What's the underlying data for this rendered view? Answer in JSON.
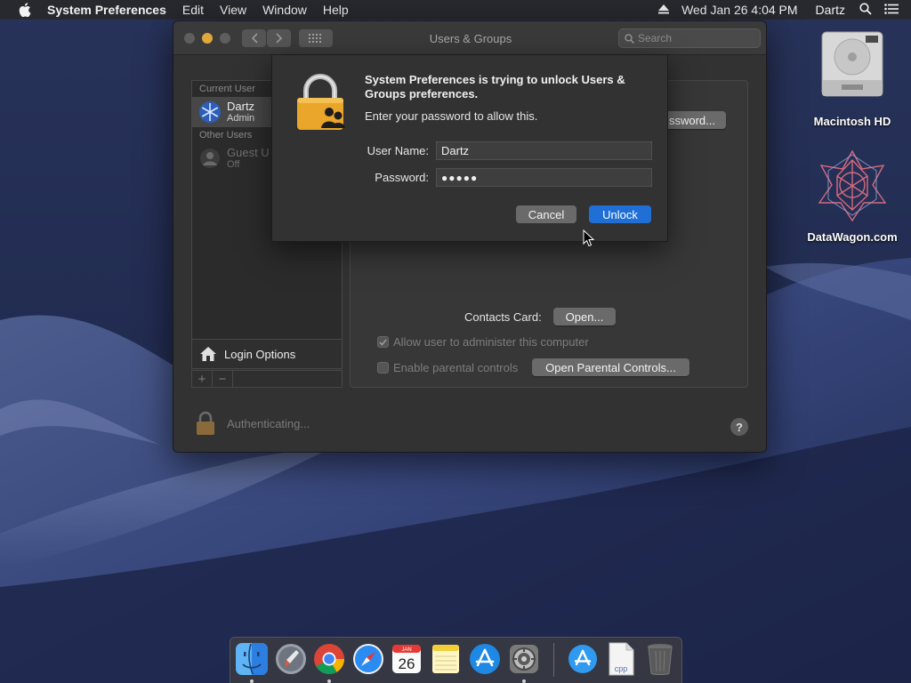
{
  "menubar": {
    "app_name": "System Preferences",
    "menus": [
      "Edit",
      "View",
      "Window",
      "Help"
    ],
    "clock": "Wed Jan 26  4:04 PM",
    "user": "Dartz"
  },
  "desktop": {
    "icons": [
      {
        "label": "Macintosh HD"
      },
      {
        "label": "DataWagon.com"
      }
    ]
  },
  "window": {
    "title": "Users & Groups",
    "search_placeholder": "Search",
    "users": {
      "current_header": "Current User",
      "current": {
        "name": "Dartz",
        "role": "Admin"
      },
      "other_header": "Other Users",
      "other": [
        {
          "name": "Guest U",
          "role": "Off"
        }
      ]
    },
    "login_options": "Login Options",
    "plus": "+",
    "minus": "−",
    "panel": {
      "password_btn_partial": "ssword...",
      "contacts_label": "Contacts Card:",
      "open_btn": "Open...",
      "allow_admin": "Allow user to administer this computer",
      "parental": "Enable parental controls",
      "open_parental_btn": "Open Parental Controls..."
    },
    "lock_status": "Authenticating...",
    "help": "?"
  },
  "sheet": {
    "title": "System Preferences is trying to unlock Users & Groups preferences.",
    "subtitle": "Enter your password to allow this.",
    "username_label": "User Name:",
    "username_value": "Dartz",
    "password_label": "Password:",
    "password_value": "●●●●●",
    "cancel": "Cancel",
    "unlock": "Unlock"
  },
  "dock": {
    "items": [
      "finder-icon",
      "launchpad-icon",
      "chrome-icon",
      "safari-icon",
      "calendar-icon",
      "notes-icon",
      "app-store-icon",
      "system-preferences-icon",
      "app-store-download-icon",
      "cpp-file-icon",
      "trash-icon"
    ],
    "calendar_month": "JAN",
    "calendar_day": "26",
    "cpp_label": "cpp"
  },
  "colors": {
    "accent": "#1f6fd6",
    "window_bg": "#323232",
    "wallpaper": "#1f2a52"
  }
}
